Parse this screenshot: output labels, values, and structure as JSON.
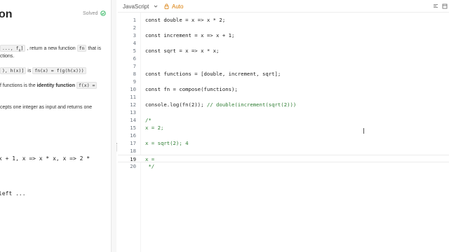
{
  "problem": {
    "title": "on",
    "status": "Solved",
    "desc_line1_pre": "...,",
    "desc_line1_chip": "fn",
    "desc_line1_mid": ", return a new function",
    "desc_line1_chip2": "fn",
    "desc_line1_post": "that is",
    "desc_line2": "ctions.",
    "desc_line3_chip": "), h(x)]",
    "desc_line3_mid": "is",
    "desc_line3_chip2": "fn(x) = f(g(h(x)))",
    "desc_line4_pre": "f functions is the",
    "desc_line4_bold": "identity function",
    "desc_line4_chip": "f(x) =",
    "desc_line5": "cepts one integer as input and returns one",
    "example_line1": " x + 1, x => x * x, x => 2 *",
    "example_line2": " left ..."
  },
  "toolbar": {
    "language": "JavaScript",
    "mode": "Auto"
  },
  "editor": {
    "lines": [
      {
        "n": "1",
        "code": "const double = x => x * 2;"
      },
      {
        "n": "2",
        "code": ""
      },
      {
        "n": "3",
        "code": "const increment = x => x + 1;"
      },
      {
        "n": "4",
        "code": ""
      },
      {
        "n": "5",
        "code": "const sqrt = x => x * x;"
      },
      {
        "n": "6",
        "code": ""
      },
      {
        "n": "7",
        "code": ""
      },
      {
        "n": "8",
        "code": "const functions = [double, increment, sqrt];"
      },
      {
        "n": "9",
        "code": ""
      },
      {
        "n": "10",
        "code": "const fn = compose(functions);"
      },
      {
        "n": "11",
        "code": ""
      },
      {
        "n": "12",
        "code": "console.log(fn(2)); ",
        "comment": "// double(increment(sqrt(2)))"
      },
      {
        "n": "13",
        "code": ""
      },
      {
        "n": "14",
        "code": "",
        "comment": "/*"
      },
      {
        "n": "15",
        "code": "",
        "comment": "x = 2;"
      },
      {
        "n": "16",
        "code": ""
      },
      {
        "n": "17",
        "code": "",
        "comment": "x = sqrt(2); 4"
      },
      {
        "n": "18",
        "code": ""
      },
      {
        "n": "19",
        "code": "",
        "comment": "x ="
      },
      {
        "n": "20",
        "code": "",
        "comment": " */"
      }
    ]
  }
}
